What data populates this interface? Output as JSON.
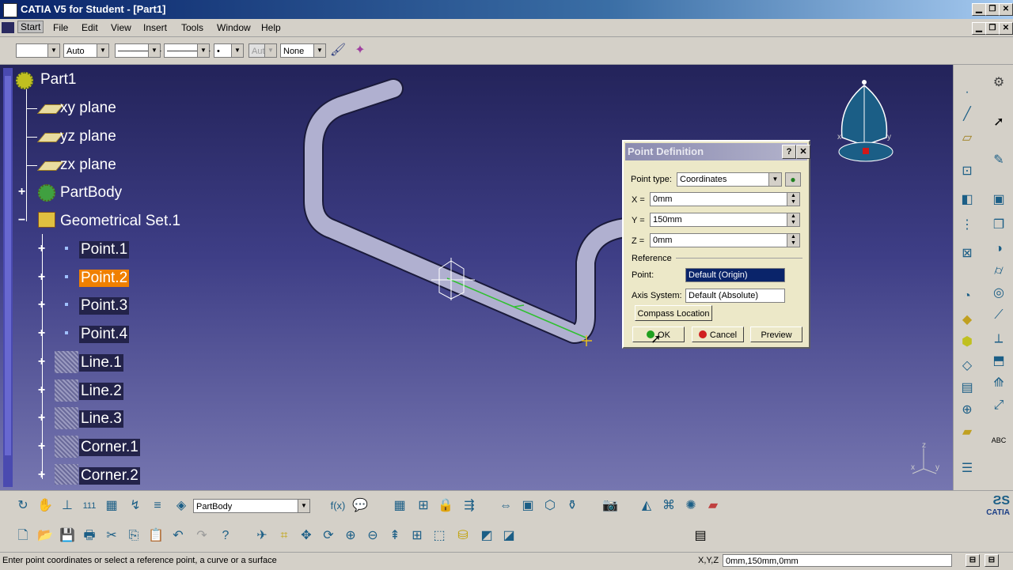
{
  "window": {
    "title": "CATIA V5 for Student - [Part1]",
    "min": "▁",
    "restore": "❐",
    "close": "✕"
  },
  "menu": {
    "items": [
      "Start",
      "File",
      "Edit",
      "View",
      "Insert",
      "Tools",
      "Window",
      "Help"
    ]
  },
  "top_toolbar": {
    "combo1": "",
    "combo2": "Auto",
    "combo3": "───────",
    "combo4": "───────",
    "combo5": "•",
    "combo6": "Aut",
    "combo7": "None"
  },
  "tree": {
    "root": "Part1",
    "items": [
      {
        "label": "xy plane"
      },
      {
        "label": "yz plane"
      },
      {
        "label": "zx plane"
      },
      {
        "label": "PartBody"
      },
      {
        "label": "Geometrical Set.1"
      }
    ],
    "children": [
      {
        "label": "Point.1"
      },
      {
        "label": "Point.2",
        "selected": true
      },
      {
        "label": "Point.3"
      },
      {
        "label": "Point.4"
      },
      {
        "label": "Line.1"
      },
      {
        "label": "Line.2"
      },
      {
        "label": "Line.3"
      },
      {
        "label": "Corner.1"
      },
      {
        "label": "Corner.2"
      }
    ]
  },
  "dialog": {
    "title": "Point Definition",
    "help": "?",
    "close": "✕",
    "point_type_label": "Point type:",
    "point_type_value": "Coordinates",
    "x_label": "X =",
    "x_value": "0mm",
    "y_label": "Y =",
    "y_value": "150mm",
    "z_label": "Z =",
    "z_value": "0mm",
    "reference_label": "Reference",
    "point_label": "Point:",
    "point_value": "Default (Origin)",
    "axis_label": "Axis System:",
    "axis_value": "Default (Absolute)",
    "compass_button": "Compass Location",
    "ok_button": "OK",
    "cancel_button": "Cancel",
    "preview_button": "Preview"
  },
  "bottom_toolbar": {
    "body_combo": "PartBody"
  },
  "status": {
    "message": "Enter point coordinates or select a reference point, a curve or a surface",
    "coord_label": "X,Y,Z",
    "coord_value": "0mm,150mm,0mm"
  },
  "compass": {
    "x": "x",
    "y": "y",
    "z": "z"
  },
  "logo": "CATIA",
  "colors": {
    "selection": "#f08000",
    "viewport_top": "#23235a",
    "viewport_bottom": "#7676b0",
    "title_bar": "#0a246a"
  }
}
